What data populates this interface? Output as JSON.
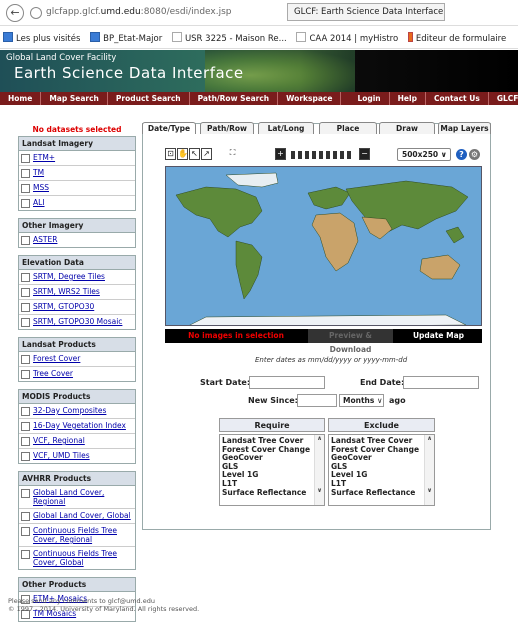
{
  "browser": {
    "url_prefix": "glcfapp.glcf.",
    "url_domain": "umd.edu",
    "url_suffix": ":8080/esdi/index.jsp",
    "tab_title": "GLCF: Earth Science Data Interface",
    "back_icon": "back-arrow-icon",
    "bookmarks": [
      {
        "label": "Les plus visités",
        "icon": "bookmark-icon"
      },
      {
        "label": "BP_Etat-Major",
        "icon": "bookmark-icon"
      },
      {
        "label": "USR 3225 - Maison Re...",
        "icon": "page-icon"
      },
      {
        "label": "CAA 2014 | myHistro",
        "icon": "page-icon"
      },
      {
        "label": "Editeur de formulaire",
        "icon": "tag-icon"
      }
    ]
  },
  "banner": {
    "facility": "Global Land Cover Facility",
    "title": "Earth Science Data Interface"
  },
  "nav": [
    "Home",
    "Map Search",
    "Product Search",
    "Path/Row Search",
    "Workspace",
    "Login",
    "Help",
    "Contact Us",
    "GLCF"
  ],
  "sidebar": {
    "no_selection": "No datasets selected",
    "groups": [
      {
        "title": "Landsat Imagery",
        "items": [
          "ETM+",
          "TM",
          "MSS",
          "ALI"
        ]
      },
      {
        "title": "Other Imagery",
        "items": [
          "ASTER"
        ]
      },
      {
        "title": "Elevation Data",
        "items": [
          "SRTM, Degree Tiles",
          "SRTM, WRS2 Tiles",
          "SRTM, GTOPO30",
          "SRTM, GTOPO30 Mosaic"
        ]
      },
      {
        "title": "Landsat Products",
        "items": [
          "Forest Cover",
          "Tree Cover"
        ]
      },
      {
        "title": "MODIS Products",
        "items": [
          "32-Day Composites",
          "16-Day Vegetation Index",
          "VCF, Regional",
          "VCF, UMD Tiles"
        ]
      },
      {
        "title": "AVHRR Products",
        "items": [
          "Global Land Cover, Regional",
          "Global Land Cover, Global",
          "Continuous Fields Tree Cover, Regional",
          "Continuous Fields Tree Cover, Global"
        ]
      },
      {
        "title": "Other Products",
        "items": [
          "ETM+ Mosaics",
          "TM Mosaics"
        ]
      }
    ]
  },
  "tabs": [
    "Date/Type",
    "Path/Row",
    "Lat/Long",
    "Place",
    "Draw",
    "Map Layers"
  ],
  "active_tab": 0,
  "toolbar": {
    "map_size": "500x250",
    "zoom_levels": 9,
    "icons": [
      "zoom-box-icon",
      "pan-hand-icon",
      "select-pointer-icon",
      "select-arrow-icon",
      "fullscreen-icon"
    ]
  },
  "status": {
    "no_images": "No images in selection",
    "preview_download": "Preview & Download",
    "update_map": "Update Map"
  },
  "search": {
    "hint": "Enter dates as mm/dd/yyyy or yyyy-mm-dd",
    "start_label": "Start Date:",
    "end_label": "End Date:",
    "new_since_label": "New Since:",
    "period": "Months",
    "ago_label": "ago"
  },
  "filters": {
    "require_label": "Require",
    "exclude_label": "Exclude",
    "options": [
      "Landsat Tree Cover",
      "Forest Cover Change",
      "GeoCover",
      "GLS",
      "Level 1G",
      "L1T",
      "Surface Reflectance"
    ]
  },
  "footer": {
    "line1": "Please send any comments to glcf@umd.edu",
    "line2": "© 1997 - 2014. University of Maryland. All rights reserved."
  },
  "colors": {
    "nav_bg": "#7a1c1c",
    "group_header": "#d7dee7",
    "warning": "#dd0000",
    "help": "#1f5fc0",
    "ocean": "#6aa6d6",
    "land": "#5d8a3a"
  }
}
